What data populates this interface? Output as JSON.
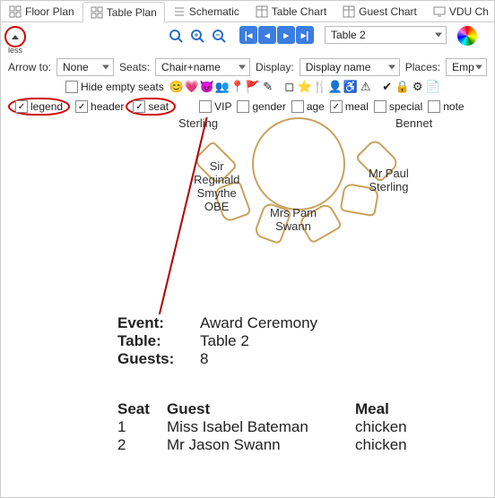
{
  "tabs": {
    "floor": "Floor Plan",
    "table": "Table Plan",
    "schematic": "Schematic",
    "tchart": "Table Chart",
    "gchart": "Guest Chart",
    "vdu": "VDU Ch"
  },
  "less": "less",
  "row2": {
    "arrow": "Arrow to:",
    "arrow_v": "None",
    "seats": "Seats:",
    "seats_v": "Chair+name",
    "display": "Display:",
    "display_v": "Display name",
    "places": "Places:",
    "places_v": "Emp"
  },
  "row3": {
    "hide": "Hide empty seats"
  },
  "row4": {
    "legend": "legend",
    "header": "header",
    "seat": "seat",
    "vip": "VIP",
    "gender": "gender",
    "age": "age",
    "meal": "meal",
    "special": "special",
    "notes": "note"
  },
  "table_name": "Table 2",
  "guests": {
    "g1": "Sterling",
    "g2": "Sir\nReginald\nSmythe\nOBE",
    "g3": "Mrs Pam\nSwann",
    "g4": "Mr Paul\nSterling",
    "g5": "Bennet"
  },
  "legend_rows": {
    "event_k": "Event:",
    "event_v": "Award Ceremony",
    "table_k": "Table:",
    "table_v": "Table 2",
    "guests_k": "Guests:",
    "guests_v": "8"
  },
  "seat_hdr": {
    "seat": "Seat",
    "guest": "Guest",
    "meal": "Meal"
  },
  "seats": [
    {
      "n": "1",
      "name": "Miss Isabel Bateman",
      "meal": "chicken"
    },
    {
      "n": "2",
      "name": "Mr Jason Swann",
      "meal": "chicken"
    }
  ]
}
